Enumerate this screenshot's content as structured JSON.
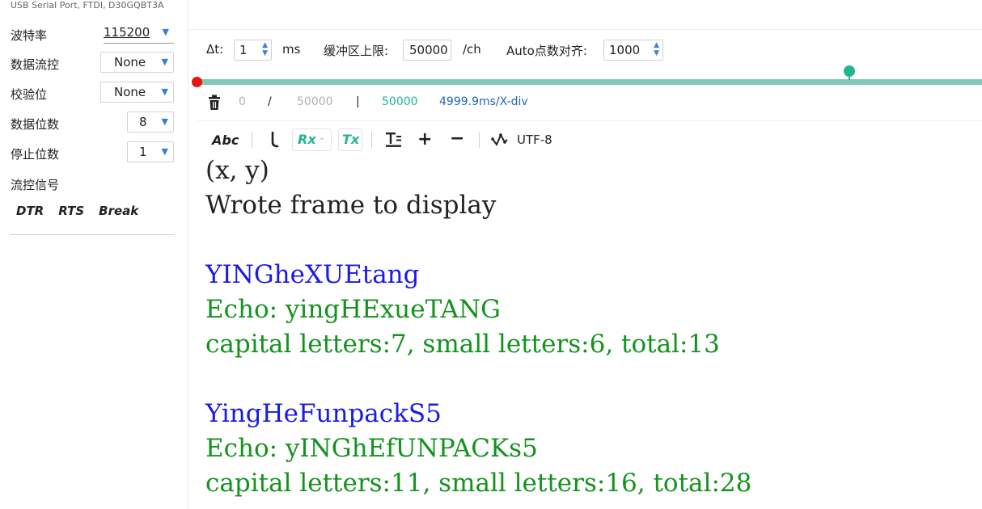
{
  "sidebar": {
    "port_name": "USB Serial Port, FTDI, D30GQBT3A",
    "settings": [
      {
        "label": "波特率",
        "value": "115200"
      },
      {
        "label": "数据流控",
        "value": "None"
      },
      {
        "label": "校验位",
        "value": "None"
      },
      {
        "label": "数据位数",
        "value": "8"
      },
      {
        "label": "停止位数",
        "value": "1"
      }
    ],
    "flow_label": "流控信号",
    "signals": [
      "DTR",
      "RTS",
      "Break"
    ]
  },
  "toolbar": {
    "dt_label": "Δt:",
    "dt_value": "1",
    "dt_unit": "ms",
    "buffer_label": "缓冲区上限:",
    "buffer_value": "50000",
    "buffer_unit": "/ch",
    "auto_label": "Auto点数对齐:",
    "auto_value": "1000"
  },
  "stats": {
    "count": "0",
    "slash": "/",
    "max": "50000",
    "bar": "|",
    "points": "50000",
    "xdiv": "4999.9ms/X-div"
  },
  "toolbar2": {
    "abc": "Abc",
    "rx": "Rx",
    "tx": "Tx",
    "encoding": "UTF-8"
  },
  "console": {
    "lines": [
      {
        "text": "(x, y)",
        "color": "#222222"
      },
      {
        "text": "Wrote frame to display",
        "color": "#222222"
      },
      {
        "text": "",
        "color": "#222222"
      },
      {
        "text": "YINGheXUEtang",
        "color": "#1a1ae6"
      },
      {
        "text": "Echo: yingHExueTANG",
        "color": "#13931d"
      },
      {
        "text": "capital letters:7, small letters:6, total:13",
        "color": "#13931d"
      },
      {
        "text": "",
        "color": "#222222"
      },
      {
        "text": "YingHeFunpackS5",
        "color": "#1a1ae6"
      },
      {
        "text": "Echo: yINGhEfUNPACKs5",
        "color": "#13931d"
      },
      {
        "text": "capital letters:11, small letters:16, total:28",
        "color": "#13931d"
      }
    ]
  },
  "icons": [
    "trash-icon",
    "chevron-down-icon",
    "plus-icon",
    "minus-icon",
    "waveform-icon",
    "text-format-icon",
    "bracket-icon"
  ]
}
